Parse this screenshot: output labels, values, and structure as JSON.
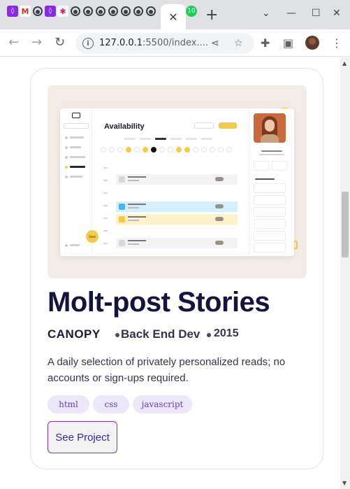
{
  "browser": {
    "active_tab_close": "✕",
    "new_tab": "+",
    "badge_count": "10",
    "url_host": "127.0.0.1",
    "url_rest": ":5500/index....",
    "info_icon": "i"
  },
  "dashboard_preview": {
    "title": "Availability",
    "start_label": "Start"
  },
  "project": {
    "title": "Molt-post Stories",
    "company": "CANOPY",
    "role": "Back End Dev",
    "year": "2015",
    "description": "A daily selection of privately personalized reads; no accounts or sign-ups required.",
    "tags": [
      "html",
      "css",
      "javascript"
    ],
    "cta_label": "See Project"
  },
  "colors": {
    "accent": "#7b2fd4",
    "title": "#16133e",
    "tag_bg": "#ece7fb",
    "tab_green": "#1fcc5a"
  }
}
